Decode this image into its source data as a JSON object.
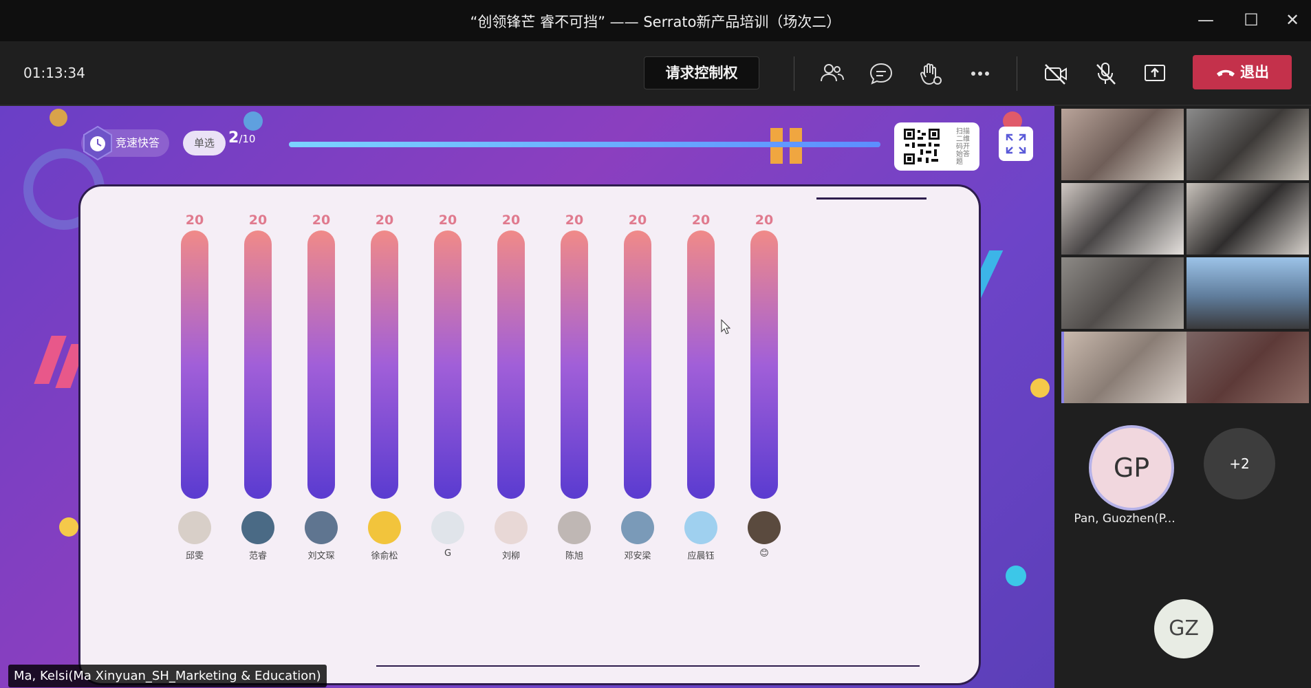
{
  "window": {
    "title": "“创领锋芒 睿不可挡” —— Serrato新产品培训（场次二）"
  },
  "toolbar": {
    "timer": "01:13:34",
    "request_control_label": "请求控制权",
    "exit_label": "退出",
    "icons": [
      "people-icon",
      "chat-icon",
      "raise-hand-icon",
      "more-icon",
      "camera-off-icon",
      "mic-off-icon",
      "share-icon",
      "phone-hangup-icon"
    ]
  },
  "quiz": {
    "mode_label": "竞速快答",
    "type_label": "单选",
    "current": "2",
    "total": "/10",
    "qr_hint": "扫描二维码开始答题",
    "bars": [
      {
        "name": "邱雯",
        "value": "20"
      },
      {
        "name": "范睿",
        "value": "20"
      },
      {
        "name": "刘文琛",
        "value": "20"
      },
      {
        "name": "徐俞松",
        "value": "20"
      },
      {
        "name": "G",
        "value": "20"
      },
      {
        "name": "刘柳",
        "value": "20"
      },
      {
        "name": "陈旭",
        "value": "20"
      },
      {
        "name": "邓安梁",
        "value": "20"
      },
      {
        "name": "应晨钰",
        "value": "20"
      },
      {
        "name": "😊",
        "value": "20"
      }
    ]
  },
  "presenter_caption": "Ma, Kelsi(Ma Xinyuan_SH_Marketing & Education)",
  "participants": {
    "gp_initials": "GP",
    "gp_name": "Pan, Guozhen(P...",
    "more_count": "+2",
    "gz_initials": "GZ"
  },
  "colors": {
    "exit_red": "#c4314b",
    "bar_top": "#f08a88",
    "bar_bottom": "#5a3bd0",
    "stage_purple": "#7a40c4"
  }
}
